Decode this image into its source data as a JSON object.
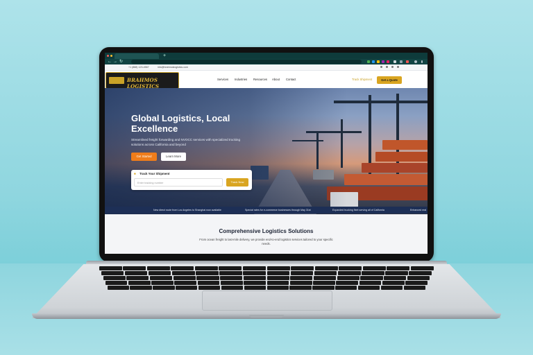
{
  "browser": {
    "new_tab_symbol": "+",
    "nav_back": "←",
    "nav_forward": "→",
    "nav_reload": "↻",
    "home_icon": "home-icon"
  },
  "topbar": {
    "phone": "+1 (888) 123-4567",
    "email": "info@brahmoslogistics.com",
    "social_icons": [
      "facebook-icon",
      "twitter-icon",
      "linkedin-icon",
      "instagram-icon"
    ]
  },
  "nav": {
    "logo_text": "BRAHMOS LOGISTICS",
    "menu": [
      "Services",
      "Industries",
      "Resources",
      "About",
      "Contact"
    ],
    "phone": "Track Shipment",
    "cta": "Get a Quote"
  },
  "hero": {
    "title_line1": "Global Logistics, Local",
    "title_line2": "Excellence",
    "subtitle": "Streamlined freight forwarding and NVOCC services with specialized trucking solutions across California and beyond",
    "primary_button": "Get Started",
    "secondary_button": "Learn More",
    "track_title": "Track Your Shipment",
    "track_placeholder": "Enter tracking number",
    "track_button": "Track Now"
  },
  "ticker": [
    "New direct route from Los Angeles to Shanghai now available",
    "Special rates for e-commerce businesses through May 31st",
    "Expanded trucking fleet serving all of California",
    "Enhanced real"
  ],
  "section": {
    "title": "Comprehensive Logistics Solutions",
    "description": "From ocean freight to last-mile delivery, we provide end-to-end logistics services tailored to your specific needs."
  },
  "colors": {
    "accent_gold": "#d9a521",
    "accent_orange": "#f07d1a",
    "navy": "#1d2f56"
  }
}
